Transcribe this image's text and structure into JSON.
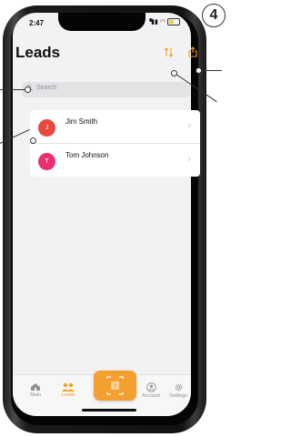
{
  "status": {
    "time": "2:47"
  },
  "header": {
    "title": "Leads",
    "sort_icon": "sort-arrows-icon",
    "share_icon": "share-icon"
  },
  "search": {
    "placeholder": "Search"
  },
  "leads": [
    {
      "initial": "J",
      "name": "Jim Smith",
      "color": "#e8473f"
    },
    {
      "initial": "T",
      "name": "Tom Johnson",
      "color": "#e8306e"
    }
  ],
  "tabbar": {
    "main": "Main",
    "leads": "Leads",
    "account": "Account",
    "settings": "Settings",
    "accent": "#f0a020"
  },
  "annotation": {
    "step": "4"
  }
}
